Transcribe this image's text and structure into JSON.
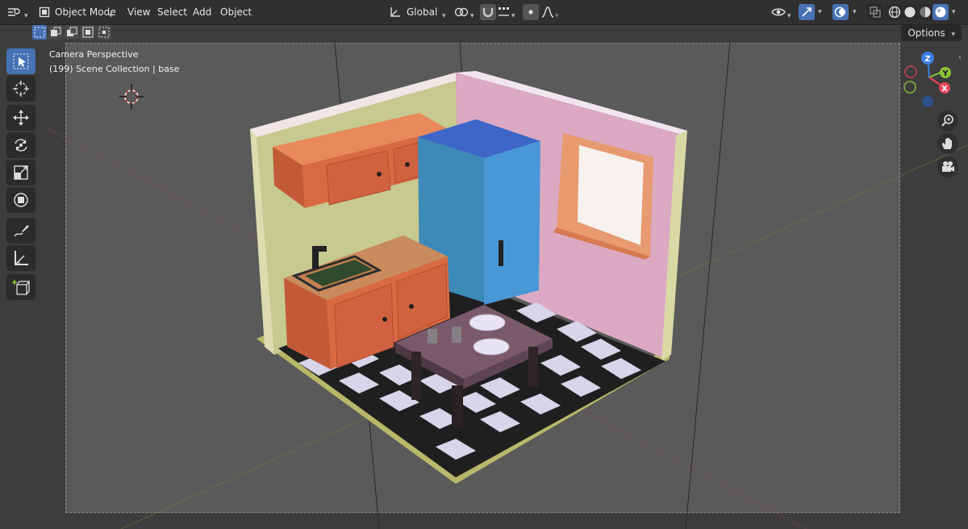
{
  "header": {
    "mode_label": "Object Mode",
    "menus": [
      "View",
      "Select",
      "Add",
      "Object"
    ],
    "transform_orientation": "Global"
  },
  "toolbar_row": {
    "options_label": "Options"
  },
  "viewport": {
    "view_name": "Camera Perspective",
    "collection_info": "(199) Scene Collection | base"
  },
  "gizmo": {
    "axis_z": "Z",
    "axis_y": "Y",
    "axis_x": "X"
  },
  "colors": {
    "accent": "#4772b3",
    "header_bg": "#303030",
    "axis_x": "#e9455a",
    "axis_y": "#8fc43a",
    "axis_z": "#3a7ee6"
  },
  "icons": {
    "tools": [
      "select-box-icon",
      "cursor-icon",
      "move-icon",
      "rotate-icon",
      "scale-icon",
      "transform-icon",
      "annotate-icon",
      "measure-icon",
      "add-cube-icon"
    ],
    "nav": [
      "zoom-icon",
      "pan-hand-icon",
      "camera-view-icon"
    ]
  }
}
